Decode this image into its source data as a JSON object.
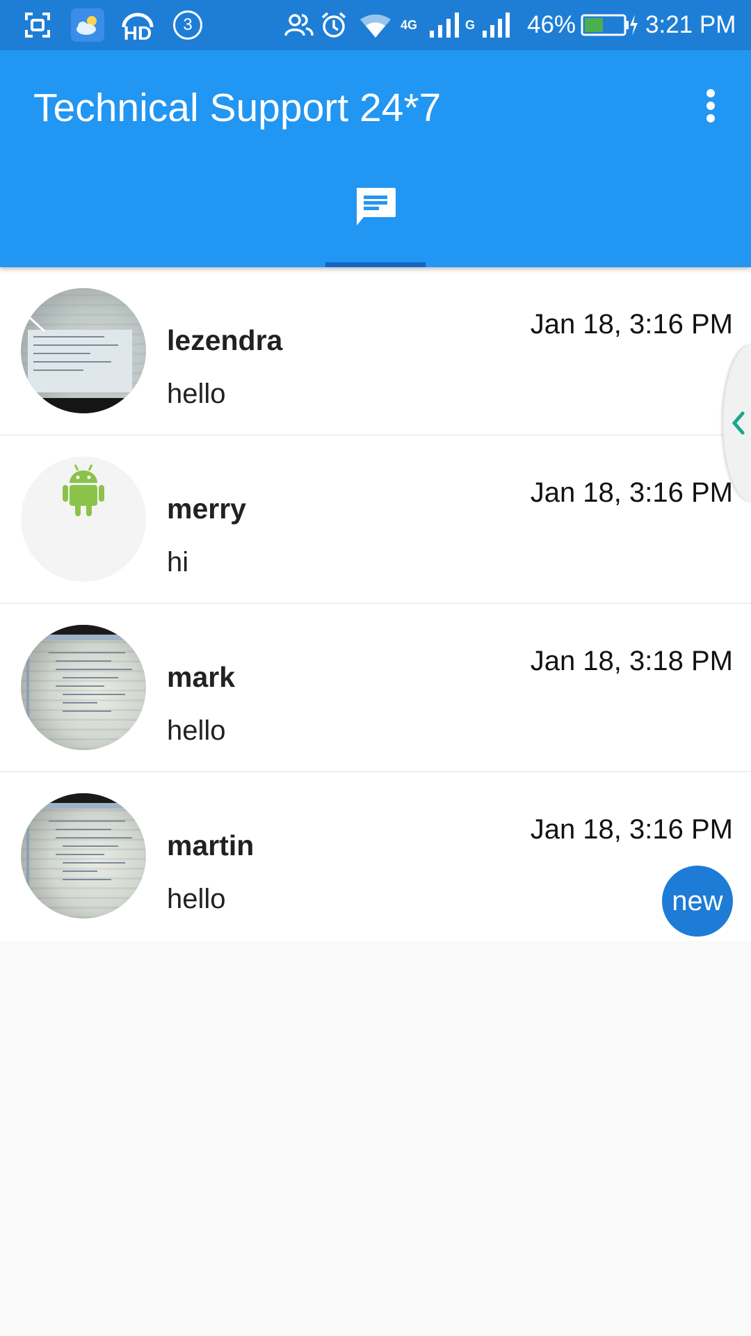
{
  "status_bar": {
    "battery_percent": "46%",
    "time": "3:21 PM",
    "notification_count": "3",
    "hd_label": "HD",
    "network_4g_label": "4G",
    "network_g_label": "G",
    "background_color": "#1e7ed6",
    "icons": [
      "screenshot-icon",
      "weather-icon",
      "hd-call-icon",
      "notification-count-icon",
      "contacts-icon",
      "alarm-icon",
      "wifi-icon",
      "signal-icon",
      "battery-icon"
    ]
  },
  "app_bar": {
    "title": "Technical Support 24*7",
    "background_color": "#2196f3",
    "menu_icon": "more-vert-icon",
    "tabs": [
      {
        "icon": "chat-icon",
        "selected": true
      }
    ]
  },
  "chats": [
    {
      "name": "lezendra",
      "message": "hello",
      "time": "Jan 18, 3:16 PM",
      "avatar": "photo",
      "new": false
    },
    {
      "name": "merry",
      "message": "hi",
      "time": "Jan 18, 3:16 PM",
      "avatar": "android-icon",
      "new": false
    },
    {
      "name": "mark",
      "message": "hello",
      "time": "Jan 18, 3:18 PM",
      "avatar": "photo",
      "new": false
    },
    {
      "name": "martin",
      "message": "hello",
      "time": "Jan 18, 3:16 PM",
      "avatar": "photo",
      "new": true,
      "badge": "new"
    }
  ],
  "edge_handle": {
    "icon": "chevron-left-icon",
    "color": "#1aa68f"
  }
}
